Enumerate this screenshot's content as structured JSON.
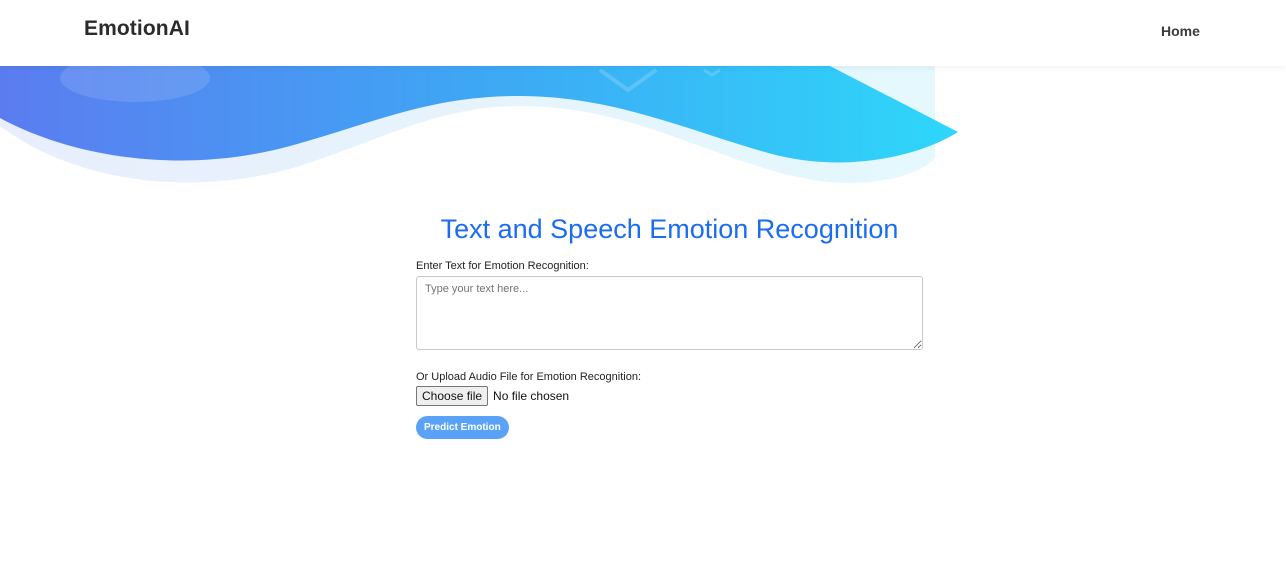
{
  "header": {
    "brand": "EmotionAI",
    "nav": [
      {
        "label": "Home"
      }
    ]
  },
  "main": {
    "title": "Text and Speech Emotion Recognition",
    "text_input": {
      "label": "Enter Text for Emotion Recognition:",
      "placeholder": "Type your text here...",
      "value": ""
    },
    "audio_input": {
      "label": "Or Upload Audio File for Emotion Recognition:",
      "button_label": "Choose file",
      "status": "No file chosen"
    },
    "submit": {
      "label": "Predict Emotion"
    }
  },
  "colors": {
    "title": "#1a6df0",
    "wave_start": "#5b7cf0",
    "wave_end": "#2ed7fa",
    "button": "#5aa2f7"
  }
}
